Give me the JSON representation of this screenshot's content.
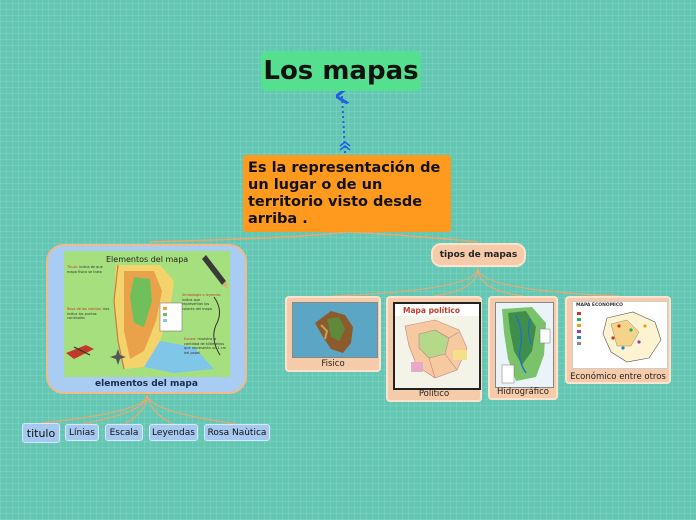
{
  "title": "Los mapas",
  "definition": {
    "lines": [
      "Es la representación de",
      "un lugar o de un",
      "territorio  visto desde",
      "arriba ."
    ]
  },
  "tipos": {
    "label": "tipos de mapas",
    "items": [
      {
        "label": "Fisico"
      },
      {
        "label": "Político",
        "thumb_title": "Mapa político"
      },
      {
        "label": "Hidrográfico"
      },
      {
        "label": "Económico entre otros",
        "thumb_title": "MAPA ECONÓMICO"
      }
    ]
  },
  "elementos": {
    "label": "elementos del mapa",
    "image": {
      "title": "Elementos del mapa",
      "notes": [
        {
          "label": "Título:",
          "text": "indica de que mapa físico se trata"
        },
        {
          "label": "Rosa de los vientos:",
          "text": "nos indica los puntos cardinales"
        },
        {
          "label": "Simbología o leyenda:",
          "text": "indica que representan los colores del mapa"
        },
        {
          "label": "Escala:",
          "text": "muestra la cantidad de kilómetros que representa un 1 cm del papel"
        }
      ]
    },
    "items": [
      {
        "label": "titulo"
      },
      {
        "label": "Línias"
      },
      {
        "label": "Escala"
      },
      {
        "label": "Leyendas"
      },
      {
        "label": "Rosa Naùtica"
      }
    ]
  },
  "colors": {
    "background": "#63c7b3",
    "title_node": "#54e08f",
    "definition_node": "#ff9a1f",
    "type_node": "#f6cbaa",
    "element_node": "#a9ccf3",
    "connector": "#e7a973",
    "arrow": "#1f5fe0"
  }
}
